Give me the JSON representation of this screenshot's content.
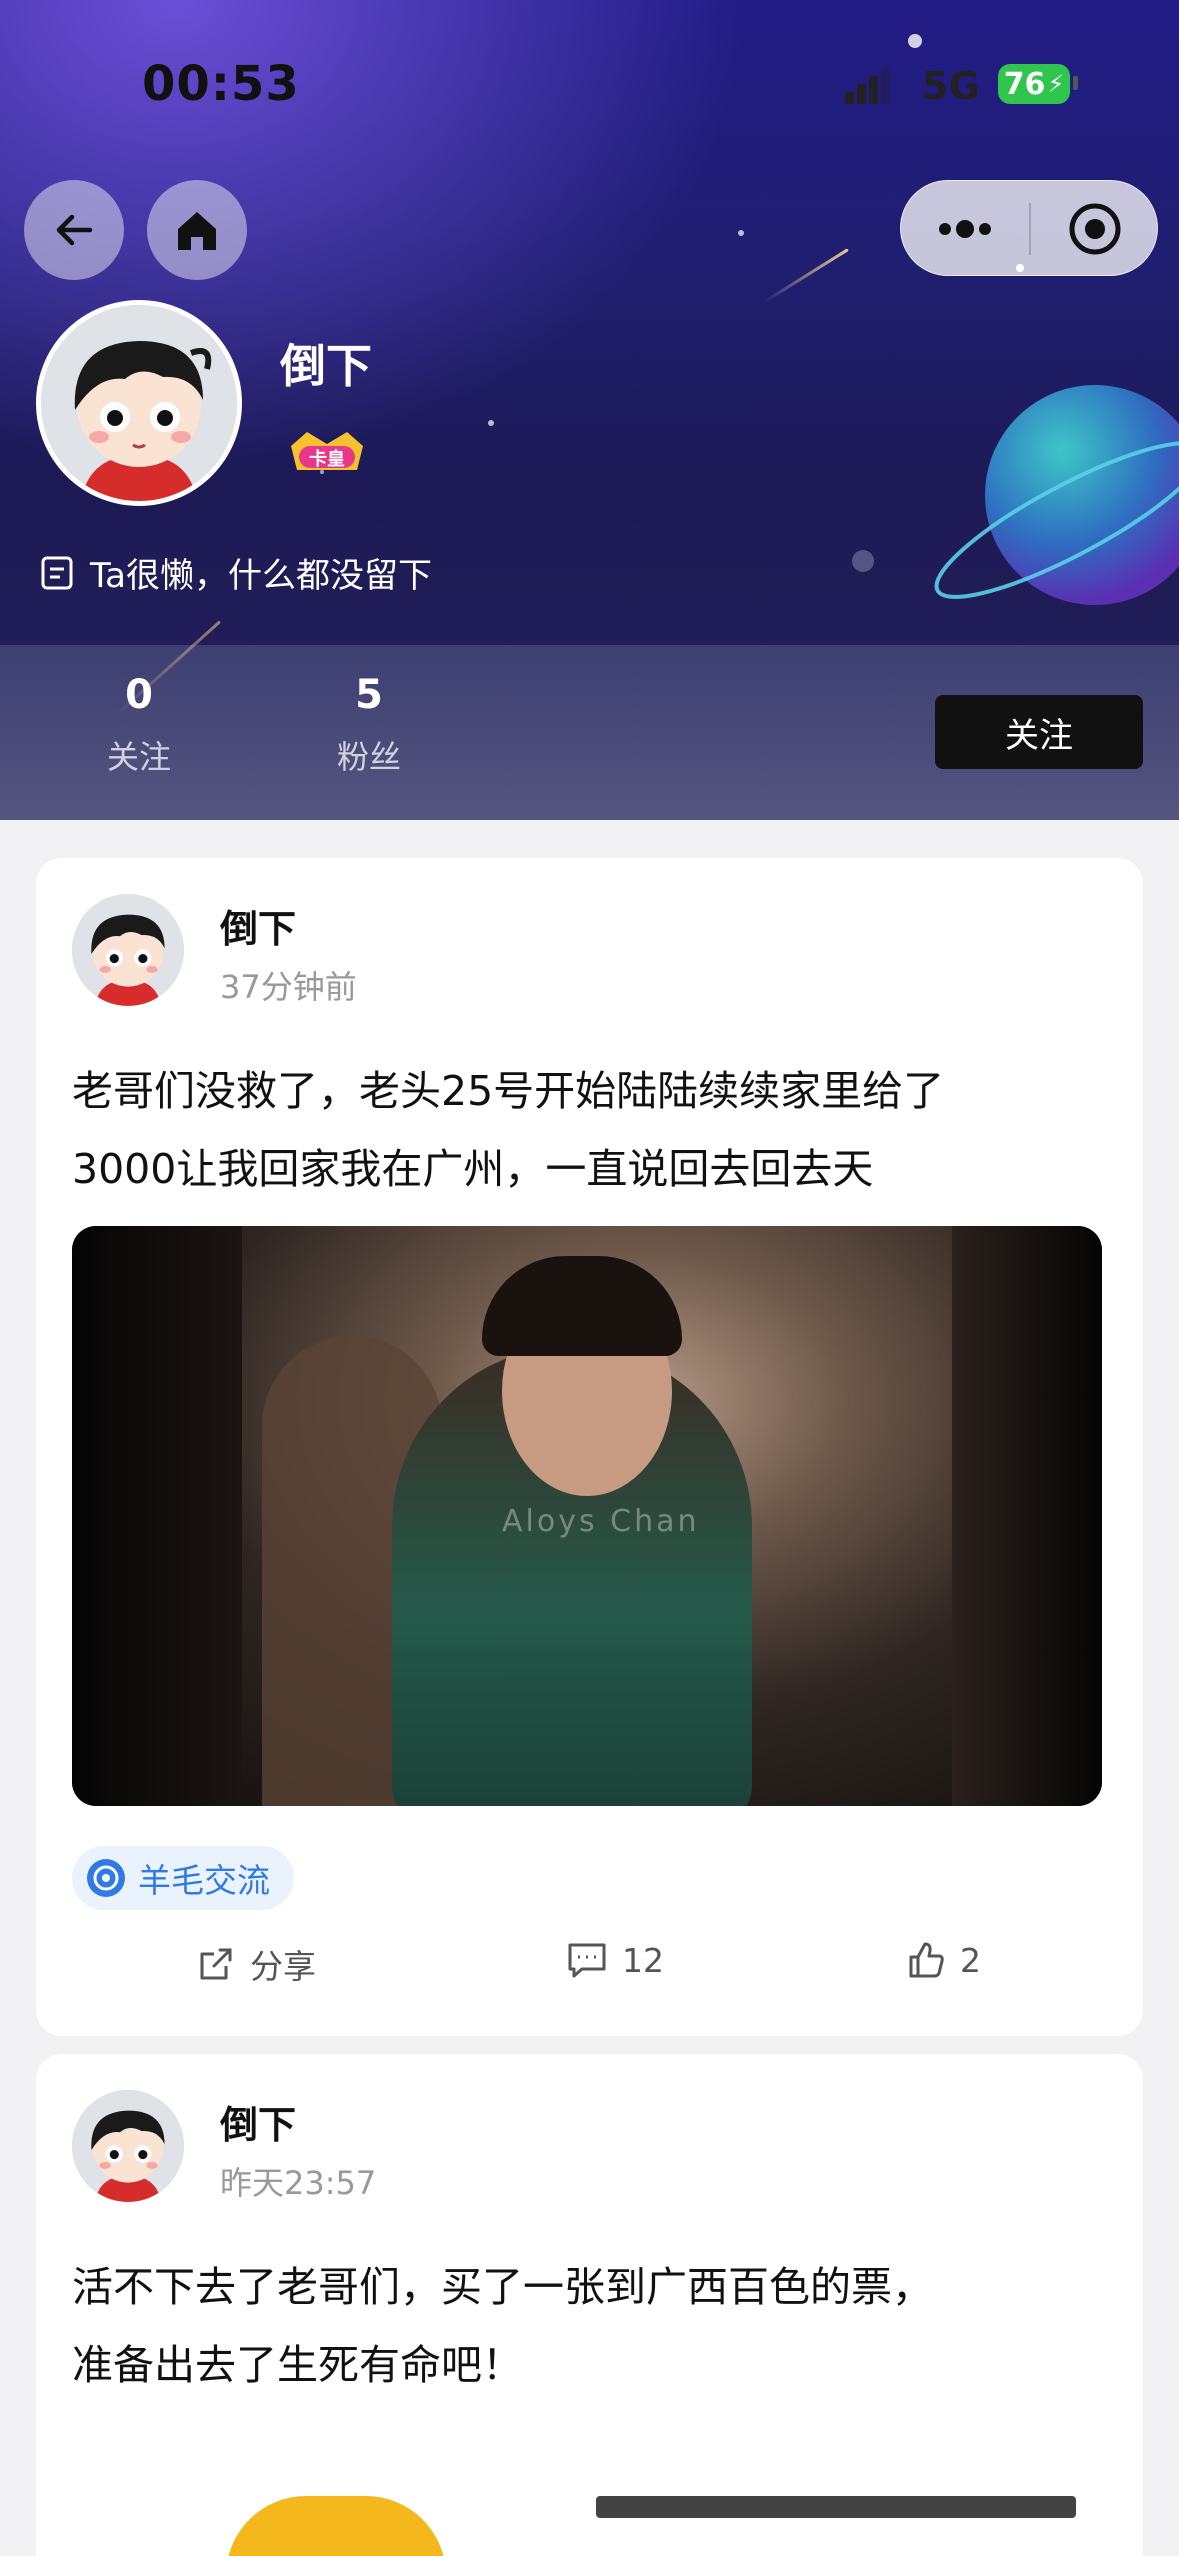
{
  "status_bar": {
    "time": "00:53",
    "network": "5G",
    "battery": "76"
  },
  "profile": {
    "name": "倒下",
    "badge_text": "卡皇",
    "bio": "Ta很懒，什么都没留下",
    "following_count": "0",
    "following_label": "关注",
    "followers_count": "5",
    "followers_label": "粉丝",
    "follow_button": "关注"
  },
  "posts": [
    {
      "author": "倒下",
      "time": "37分钟前",
      "text_line1": "老哥们没救了，老头25号开始陆陆续续家里给了",
      "text_line2": "3000让我回家我在广州，一直说回去回去天",
      "image_watermark": "Aloys Chan",
      "tag": "羊毛交流",
      "share_label": "分享",
      "comments": "12",
      "likes": "2"
    },
    {
      "author": "倒下",
      "time": "昨天23:57",
      "text_line1": "活不下去了老哥们，买了一张到广西百色的票，",
      "text_line2": "准备出去了生死有命吧！"
    }
  ],
  "colors": {
    "accent": "#2f7ae5",
    "header": "#1f1e6e",
    "follow_bg": "#111111"
  }
}
